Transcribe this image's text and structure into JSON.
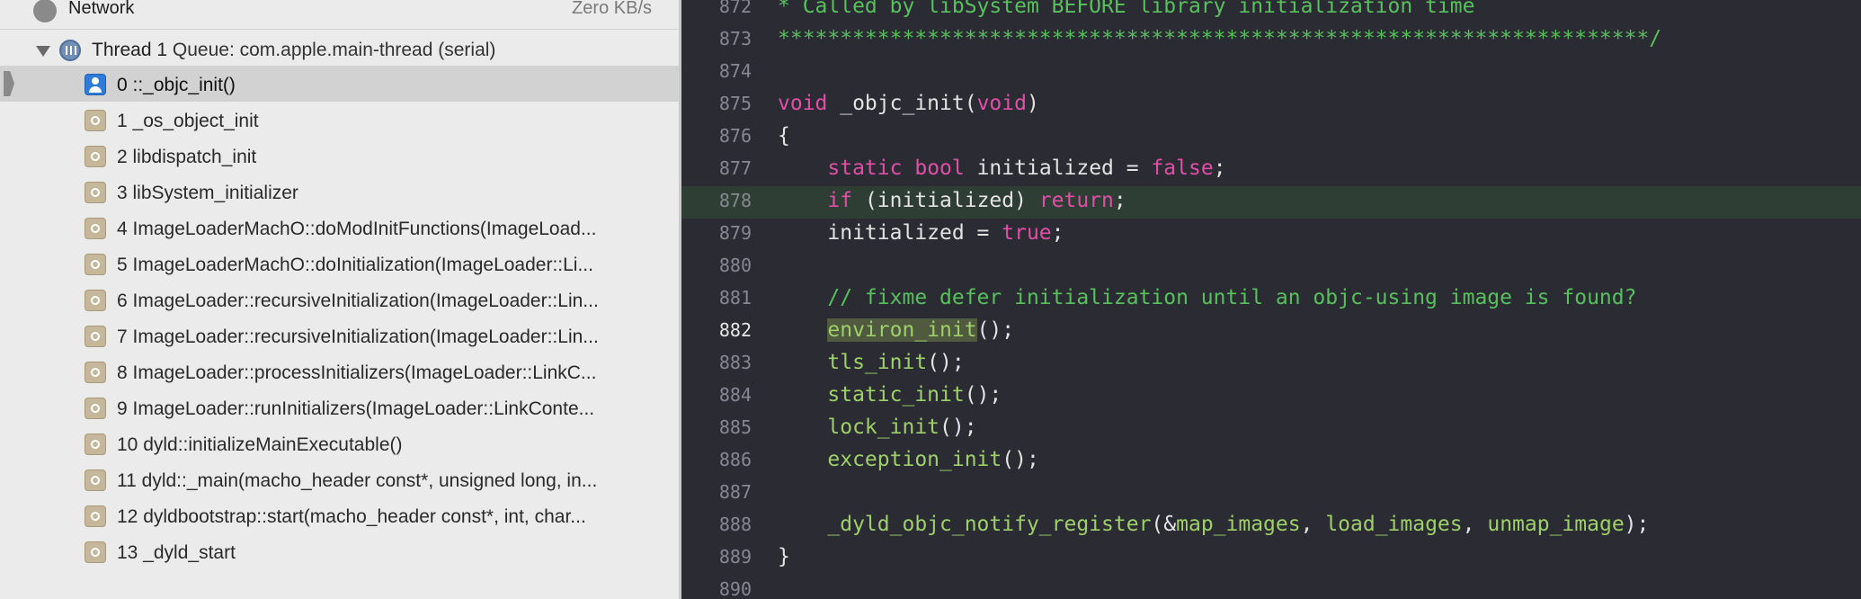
{
  "navigator": {
    "network": {
      "label": "Network",
      "value": "Zero KB/s"
    },
    "thread": {
      "title": "Thread 1",
      "queue": "Queue: com.apple.main-thread (serial)"
    },
    "frames": [
      {
        "label": "0 ::_objc_init()",
        "icon": "user-code-icon",
        "selected": true
      },
      {
        "label": "1 _os_object_init",
        "icon": "gear-icon"
      },
      {
        "label": "2 libdispatch_init",
        "icon": "gear-icon"
      },
      {
        "label": "3 libSystem_initializer",
        "icon": "gear-icon"
      },
      {
        "label": "4 ImageLoaderMachO::doModInitFunctions(ImageLoad...",
        "icon": "gear-icon"
      },
      {
        "label": "5 ImageLoaderMachO::doInitialization(ImageLoader::Li...",
        "icon": "gear-icon"
      },
      {
        "label": "6 ImageLoader::recursiveInitialization(ImageLoader::Lin...",
        "icon": "gear-icon"
      },
      {
        "label": "7 ImageLoader::recursiveInitialization(ImageLoader::Lin...",
        "icon": "gear-icon"
      },
      {
        "label": "8 ImageLoader::processInitializers(ImageLoader::LinkC...",
        "icon": "gear-icon"
      },
      {
        "label": "9 ImageLoader::runInitializers(ImageLoader::LinkConte...",
        "icon": "gear-icon"
      },
      {
        "label": "10 dyld::initializeMainExecutable()",
        "icon": "gear-icon"
      },
      {
        "label": "11 dyld::_main(macho_header const*, unsigned long, in...",
        "icon": "gear-icon"
      },
      {
        "label": "12 dyldbootstrap::start(macho_header const*, int, char...",
        "icon": "gear-icon"
      },
      {
        "label": "13 _dyld_start",
        "icon": "gear-icon"
      }
    ]
  },
  "editor": {
    "current_line": "882",
    "highlighted_line": "878",
    "lines": [
      {
        "num": "872",
        "text": "* Called by libSystem BEFORE library initialization time"
      },
      {
        "num": "873",
        "text": "**********************************************************************/"
      },
      {
        "num": "874",
        "text": ""
      },
      {
        "num": "875",
        "kw1": "void",
        "plain1": " _objc_init(",
        "kw2": "void",
        "plain2": ")"
      },
      {
        "num": "876",
        "text": "{"
      },
      {
        "num": "877",
        "indent": "    ",
        "kw1": "static",
        "sp": " ",
        "kw2": "bool",
        "plain1": " initialized = ",
        "kw3": "false",
        "plain2": ";"
      },
      {
        "num": "878",
        "indent": "    ",
        "kw1": "if",
        "plain1": " (initialized) ",
        "kw2": "return",
        "plain2": ";"
      },
      {
        "num": "879",
        "plain1": "    initialized = ",
        "kw1": "true",
        "plain2": ";"
      },
      {
        "num": "880",
        "text": ""
      },
      {
        "num": "881",
        "indent": "    ",
        "comment": "// fixme defer initialization until an objc-using image is found?"
      },
      {
        "num": "882",
        "indent": "    ",
        "fn": "environ_init",
        "plain": "();"
      },
      {
        "num": "883",
        "indent": "    ",
        "fn": "tls_init",
        "plain": "();"
      },
      {
        "num": "884",
        "indent": "    ",
        "fn": "static_init",
        "plain": "();"
      },
      {
        "num": "885",
        "indent": "    ",
        "fn": "lock_init",
        "plain": "();"
      },
      {
        "num": "886",
        "indent": "    ",
        "fn": "exception_init",
        "plain": "();"
      },
      {
        "num": "887",
        "text": ""
      },
      {
        "num": "888",
        "indent": "    ",
        "fn": "_dyld_objc_notify_register",
        "p1": "(&",
        "a1": "map_images",
        "p2": ", ",
        "a2": "load_images",
        "p3": ", ",
        "a3": "unmap_image",
        "p4": ");"
      },
      {
        "num": "889",
        "text": "}"
      },
      {
        "num": "890",
        "text": ""
      }
    ]
  },
  "colors": {
    "keyword": "#e04fa6",
    "comment": "#57c05d",
    "function": "#9ecf6a",
    "editor_background": "#2b2c33",
    "navigator_background": "#ebebeb"
  }
}
